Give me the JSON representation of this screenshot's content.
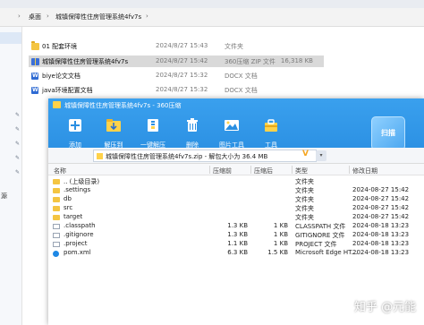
{
  "explorer": {
    "breadcrumbs": [
      "桌面",
      "城镇保障性住房管理系统4fv7s"
    ],
    "files": [
      {
        "name": "01 配套环境",
        "date": "2024/8/27 15:43",
        "type": "文件夹",
        "size": "",
        "icon": "folder-icon"
      },
      {
        "name": "城镇保障性住房管理系统4fv7s",
        "date": "2024/8/27 15:42",
        "type": "360压缩 ZIP 文件",
        "size": "16,318 KB",
        "icon": "zip-icon"
      },
      {
        "name": "biye论文文档",
        "date": "2024/8/27 15:32",
        "type": "DOCX 文档",
        "size": "",
        "icon": "word-doc-icon"
      },
      {
        "name": "java环境配置文档",
        "date": "2024/8/27 15:32",
        "type": "DOCX 文档",
        "size": "",
        "icon": "word-doc-icon"
      }
    ],
    "left_pane_label": "源"
  },
  "zipwin": {
    "title": "城镇保障性住房管理系统4fv7s - 360压缩",
    "toolbar": [
      {
        "label": "添加",
        "icon": "add-icon",
        "color": "#ffd24a"
      },
      {
        "label": "解压到",
        "icon": "extract-to-icon",
        "color": "#ffd24a"
      },
      {
        "label": "一键解压",
        "icon": "one-click-extract-icon",
        "color": "#ffffff"
      },
      {
        "label": "删除",
        "icon": "delete-icon",
        "color": "#ffffff"
      },
      {
        "label": "图片工具",
        "icon": "image-tool-icon",
        "color": "#ffffff"
      },
      {
        "label": "工具",
        "icon": "tools-icon",
        "color": "#ffd24a"
      }
    ],
    "badge": "扫描",
    "path": "城镇保障性住房管理系统4fv7s.zip - 解包大小为 36.4 MB",
    "columns": [
      "名称",
      "压缩前",
      "压缩后",
      "类型",
      "修改日期"
    ],
    "rows": [
      {
        "name": ".. (上级目录)",
        "before": "",
        "after": "",
        "type": "文件夹",
        "date": "",
        "icon": "folder-icon"
      },
      {
        "name": ".settings",
        "before": "",
        "after": "",
        "type": "文件夹",
        "date": "2024-08-27 15:42",
        "icon": "folder-icon"
      },
      {
        "name": "db",
        "before": "",
        "after": "",
        "type": "文件夹",
        "date": "2024-08-27 15:42",
        "icon": "folder-icon"
      },
      {
        "name": "src",
        "before": "",
        "after": "",
        "type": "文件夹",
        "date": "2024-08-27 15:42",
        "icon": "folder-icon"
      },
      {
        "name": "target",
        "before": "",
        "after": "",
        "type": "文件夹",
        "date": "2024-08-27 15:42",
        "icon": "folder-icon"
      },
      {
        "name": ".classpath",
        "before": "1.3 KB",
        "after": "1 KB",
        "type": "CLASSPATH 文件",
        "date": "2024-08-18 13:23",
        "icon": "file-icon"
      },
      {
        "name": ".gitignore",
        "before": "1.3 KB",
        "after": "1 KB",
        "type": "GITIGNORE 文件",
        "date": "2024-08-18 13:23",
        "icon": "file-icon"
      },
      {
        "name": ".project",
        "before": "1.1 KB",
        "after": "1 KB",
        "type": "PROJECT 文件",
        "date": "2024-08-18 13:23",
        "icon": "file-icon"
      },
      {
        "name": "pom.xml",
        "before": "6.3 KB",
        "after": "1.5 KB",
        "type": "Microsoft Edge HT...",
        "date": "2024-08-18 13:23",
        "icon": "edge-xml-icon"
      }
    ]
  },
  "watermark": "知乎 @元能"
}
